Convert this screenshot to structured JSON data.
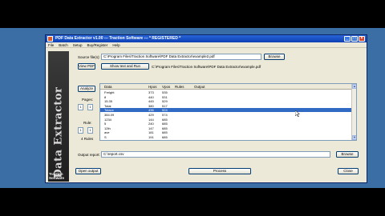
{
  "window": {
    "title": "PDF Data Extractor v1.00  --- Traction Software ---  * REGISTERED *",
    "menu": [
      "File",
      "Batch",
      "Setup",
      "Buy/Register",
      "Help"
    ]
  },
  "sidebar": {
    "logo_text": "PDF Data Extractor",
    "brand_line1": "Traction",
    "brand_line2": "Software"
  },
  "source": {
    "label": "Source file(s):",
    "value": "C:\\Program Files\\Traction Software\\PDF Data Extractor\\example2.pdf",
    "browse_label": "Browse"
  },
  "view": {
    "view_pdf_label": "View PDF",
    "show_text_label": "Show text and Run",
    "current_file": "C:\\Program Files\\Traction Software\\PDF Data Extractor\\example.pdf"
  },
  "options": {
    "analyze_label": "Analyze",
    "pages_label": "Pages:",
    "pages_from": "1",
    "pages_to": "1",
    "rules_label": "Rule:",
    "rules_from": "1",
    "rules_to": "1",
    "rules_count": "4 Rules"
  },
  "table": {
    "columns": [
      "Data",
      "Hpos",
      "Vpos",
      "Rules",
      "Output"
    ],
    "rows": [
      {
        "data": "Freight",
        "hpos": "373",
        "vpos": "535",
        "selected": false
      },
      {
        "data": "8",
        "hpos": "440",
        "vpos": "531",
        "selected": false
      },
      {
        "data": "15.35",
        "hpos": "445",
        "vpos": "529",
        "selected": false
      },
      {
        "data": "Total",
        "hpos": "380",
        "vpos": "517",
        "selected": false
      },
      {
        "data": "Totaux",
        "hpos": "436",
        "vpos": "524",
        "selected": true
      },
      {
        "data": "384.09",
        "hpos": "429",
        "vpos": "574",
        "selected": false
      },
      {
        "data": "1234",
        "hpos": "144",
        "vpos": "685",
        "selected": false
      },
      {
        "data": "5",
        "hpos": "240",
        "vpos": "685",
        "selected": false
      },
      {
        "data": "12th",
        "hpos": "147",
        "vpos": "685",
        "selected": false
      },
      {
        "data": "ave",
        "hpos": "181",
        "vpos": "685",
        "selected": false
      },
      {
        "data": "S",
        "hpos": "191",
        "vpos": "685",
        "selected": false
      }
    ]
  },
  "output": {
    "label": "Output report:",
    "value": "C:\\report.csv",
    "browse_label": "Browse"
  },
  "bottom": {
    "open_output_label": "Open output",
    "process_label": "Process",
    "close_label": "Close"
  },
  "colors": {
    "title_bar": "#0b3fb3",
    "desktop": "#3a6ea5",
    "selection": "#316ac5",
    "window_face": "#ece9d8"
  }
}
